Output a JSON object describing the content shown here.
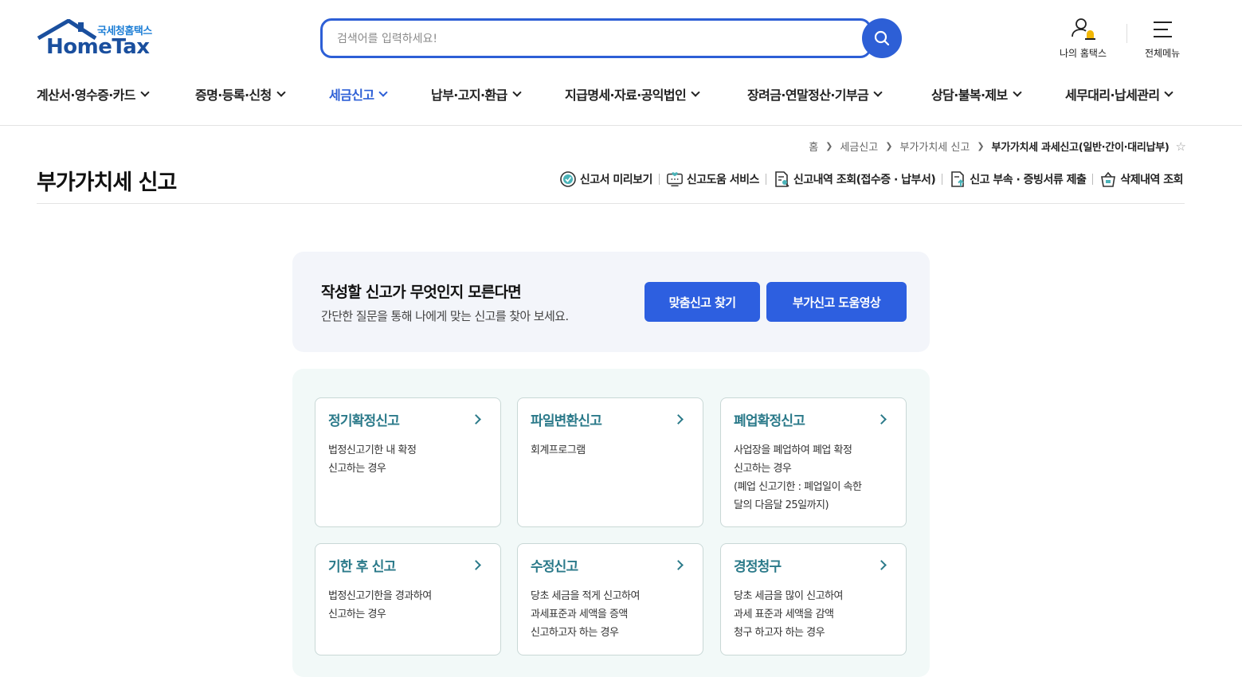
{
  "header": {
    "logo_sub": "국세청홈택스",
    "logo_main": "HomeTax",
    "search_placeholder": "검색어를 입력하세요!",
    "my_hometax": "나의 홈택스",
    "all_menu": "전체메뉴"
  },
  "gnb": [
    {
      "label": "계산서·영수증·카드",
      "active": false
    },
    {
      "label": "증명·등록·신청",
      "active": false
    },
    {
      "label": "세금신고",
      "active": true
    },
    {
      "label": "납부·고지·환급",
      "active": false
    },
    {
      "label": "지급명세·자료·공익법인",
      "active": false
    },
    {
      "label": "장려금·연말정산·기부금",
      "active": false
    },
    {
      "label": "상담·불복·제보",
      "active": false
    },
    {
      "label": "세무대리·납세관리",
      "active": false
    }
  ],
  "breadcrumb": {
    "home": "홈",
    "level1": "세금신고",
    "level2": "부가가치세 신고",
    "current": "부가가치세 과세신고(일반·간이·대리납부)"
  },
  "page": {
    "title": "부가가치세 신고"
  },
  "quick_links": {
    "preview": "신고서 미리보기",
    "help_service": "신고도움 서비스",
    "history": "신고내역 조회(접수증 · 납부서)",
    "attach": "신고 부속 · 증빙서류 제출",
    "deleted": "삭제내역 조회"
  },
  "banner": {
    "heading": "작성할 신고가 무엇인지 모른다면",
    "desc": "간단한 질문을 통해 나에게 맞는 신고를 찾아 보세요.",
    "btn_find": "맞춤신고 찾기",
    "btn_video": "부가신고 도움영상"
  },
  "cards": [
    {
      "title": "정기확정신고",
      "lines": [
        "법정신고기한 내 확정",
        "신고하는 경우"
      ]
    },
    {
      "title": "파일변환신고",
      "lines": [
        "회계프로그램"
      ]
    },
    {
      "title": "폐업확정신고",
      "lines": [
        "사업장을 폐업하여 폐업 확정",
        "신고하는 경우",
        "(폐업 신고기한 : 폐업일이 속한",
        "달의 다음달 25일까지)"
      ]
    },
    {
      "title": "기한 후 신고",
      "lines": [
        "법정신고기한을 경과하여",
        "신고하는 경우"
      ]
    },
    {
      "title": "수정신고",
      "lines": [
        "당초 세금을 적게 신고하여",
        "과세표준과 세액을 증액",
        "신고하고자 하는 경우"
      ]
    },
    {
      "title": "경정청구",
      "lines": [
        "당초 세금을 많이 신고하여",
        "과세 표준과 세액을 감액",
        "청구 하고자 하는 경우"
      ]
    }
  ],
  "colors": {
    "primary": "#2d5fd6",
    "card_title": "#2b7a8a",
    "logo": "#1a4f9e"
  }
}
